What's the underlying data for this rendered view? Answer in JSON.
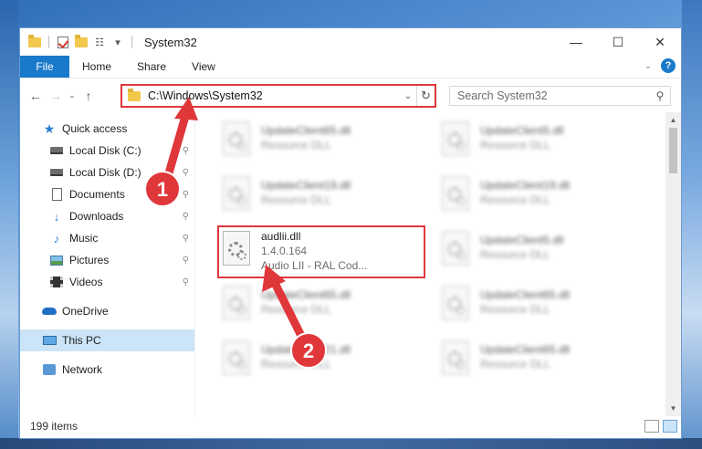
{
  "window": {
    "title": "System32",
    "controls": {
      "minimize": "—",
      "maximize": "☐",
      "close": "✕"
    }
  },
  "quick_access": {
    "dropdown": "▾"
  },
  "ribbon": {
    "tabs": [
      "File",
      "Home",
      "Share",
      "View"
    ],
    "expand": "⌄",
    "help": "?"
  },
  "nav": {
    "back": "←",
    "forward": "→",
    "recent": "⌄",
    "up": "↑",
    "address": "C:\\Windows\\System32",
    "address_dropdown": "⌄",
    "refresh": "↻",
    "search_placeholder": "Search System32",
    "search_icon": "⚲"
  },
  "sidebar": {
    "items": [
      {
        "label": "Quick access",
        "icon": "star-icon",
        "pinned": false
      },
      {
        "label": "Local Disk (C:)",
        "icon": "disk-icon",
        "pinned": true
      },
      {
        "label": "Local Disk (D:)",
        "icon": "disk-icon",
        "pinned": true
      },
      {
        "label": "Documents",
        "icon": "documents-icon",
        "pinned": true
      },
      {
        "label": "Downloads",
        "icon": "download-icon",
        "pinned": true
      },
      {
        "label": "Music",
        "icon": "music-icon",
        "pinned": true
      },
      {
        "label": "Pictures",
        "icon": "pictures-icon",
        "pinned": true
      },
      {
        "label": "Videos",
        "icon": "videos-icon",
        "pinned": true
      },
      {
        "label": "OneDrive",
        "icon": "cloud-icon",
        "pinned": false
      },
      {
        "label": "This PC",
        "icon": "pc-icon",
        "pinned": false,
        "selected": true
      },
      {
        "label": "Network",
        "icon": "network-icon",
        "pinned": false
      }
    ],
    "pin_glyph": "📌"
  },
  "files": {
    "left": [
      {
        "name": "UpdateClient65.dll",
        "sub": "Resource DLL"
      },
      {
        "name": "UpdateClient19.dll",
        "sub": "Resource DLL"
      },
      {
        "name": "audlii.dll",
        "version": "1.4.0.164",
        "desc": "Audio LII - RAL Cod..."
      },
      {
        "name": "UpdateClient65.dll",
        "sub": "Resource DLL"
      },
      {
        "name": "UpdateClient21.dll",
        "sub": "Resource DLL"
      }
    ],
    "right": [
      {
        "name": "UpdateClient5.dll",
        "sub": "Resource DLL"
      },
      {
        "name": "UpdateClient19.dll",
        "sub": "Resource DLL"
      },
      {
        "name": "UpdateClient5.dll",
        "sub": "Resource DLL"
      },
      {
        "name": "UpdateClient65.dll",
        "sub": "Resource DLL"
      },
      {
        "name": "UpdateClient65.dll",
        "sub": "Resource DLL"
      }
    ]
  },
  "scrollbar": {
    "up": "▲",
    "down": "▼"
  },
  "status": {
    "item_count": "199 items"
  },
  "annotations": {
    "step1": "1",
    "step2": "2"
  },
  "colors": {
    "accent": "#1979ca",
    "highlight": "#e0373b",
    "selected_bg": "#cce4f7"
  }
}
